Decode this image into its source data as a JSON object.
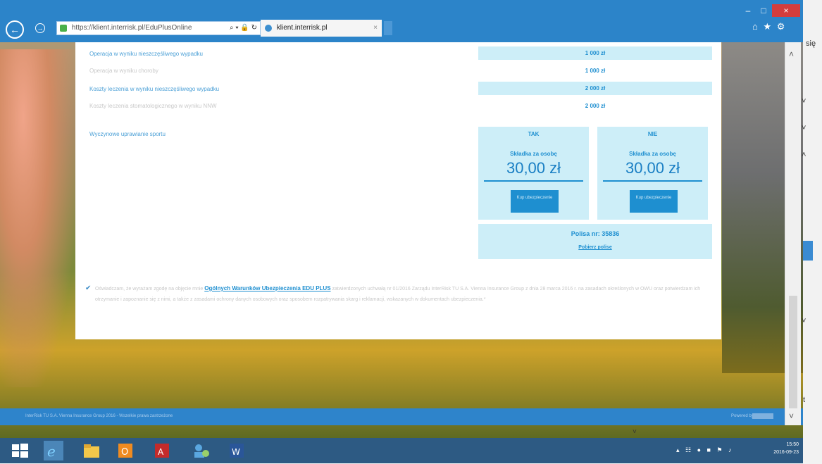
{
  "browser": {
    "address_url": "https://klient.interrisk.pl/EduPlusOnline",
    "addr_controls": "⌕ ▾ 🔒 ↻",
    "tab_title": "klient.interrisk.pl",
    "tab_close": "×",
    "minimize": "–",
    "maximize": "□",
    "close": "×",
    "toolbar_icons": "⌂ ★ ⚙"
  },
  "coverage_rows": [
    {
      "label": "Operacja w wyniku nieszczęśliwego wypadku",
      "value": "1 000 zł",
      "shaded": true,
      "muted": false
    },
    {
      "label": "Operacja w wyniku choroby",
      "value": "1 000 zł",
      "shaded": false,
      "muted": true
    },
    {
      "label": "Koszty leczenia w wyniku nieszczęśliwego wypadku",
      "value": "2 000 zł",
      "shaded": true,
      "muted": false
    },
    {
      "label": "Koszty leczenia stomatologicznego w wyniku NNW",
      "value": "2 000 zł",
      "shaded": false,
      "muted": true
    }
  ],
  "sport": {
    "label": "Wyczynowe uprawianie sportu",
    "options": [
      {
        "name": "TAK",
        "sub": "Składka za osobę",
        "price": "30,00 zł",
        "button": "Kup ubezpieczenie"
      },
      {
        "name": "NIE",
        "sub": "Składka za osobę",
        "price": "30,00 zł",
        "button": "Kup ubezpieczenie"
      }
    ]
  },
  "policy": {
    "number": "Polisa nr: 35836",
    "link": "Pobierz polisę"
  },
  "consent": {
    "check": "✔",
    "text_before": "Oświadczam, że wyrażam zgodę na objęcie mnie",
    "link": "Ogólnych Warunków Ubezpieczenia EDU PLUS",
    "text_after": "zatwierdzonych uchwałą nr 01/2016 Zarządu InterRisk TU S.A. Vienna Insurance Group z dnia 28 marca 2016 r. na zasadach określonych w OWU oraz potwierdzam ich otrzymanie i zapoznanie się z nimi, a także z zasadami ochrony danych osobowych oraz sposobem rozpatrywania skarg i reklamacji, wskazanych w dokumentach ubezpieczenia.*"
  },
  "footer": {
    "left": "InterRisk TU S.A. Vienna Insurance Group 2016 - Wszelkie prawa zastrzeżone",
    "right": "Powered by"
  },
  "taskbar": {
    "time": "15:50",
    "date": "2016-09-23",
    "tray_icons": "▴ ☷ ● ■ ⚑ ♪"
  },
  "side_text": {
    "word": "się",
    "chevrons": [
      "˅",
      "˅",
      "˄",
      "˅",
      "˅"
    ],
    "t": "t",
    "down": "˅"
  }
}
